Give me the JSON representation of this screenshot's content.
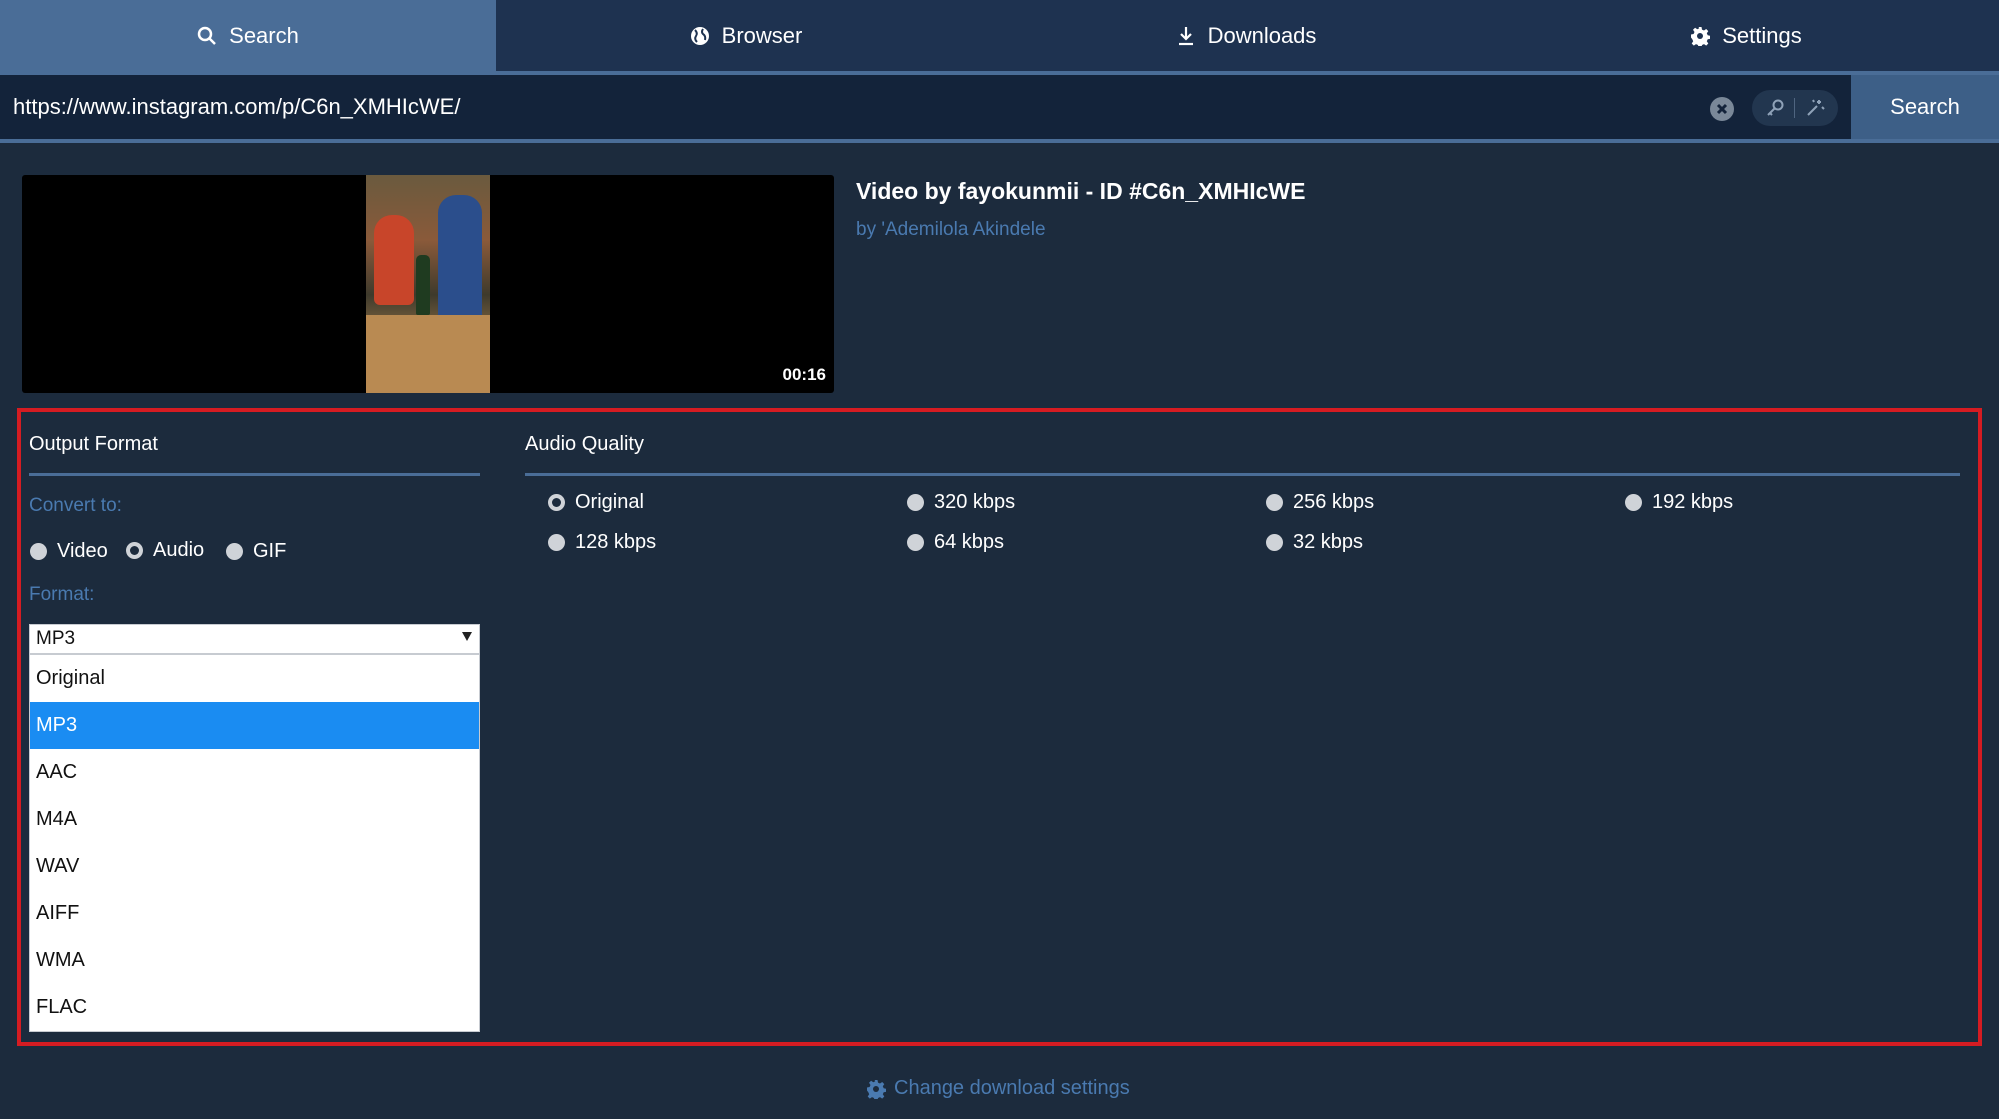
{
  "tabs": [
    {
      "label": "Search",
      "icon": "search-icon",
      "active": true
    },
    {
      "label": "Browser",
      "icon": "globe-icon",
      "active": false
    },
    {
      "label": "Downloads",
      "icon": "download-icon",
      "active": false
    },
    {
      "label": "Settings",
      "icon": "gear-icon",
      "active": false
    }
  ],
  "url_bar": {
    "value": "https://www.instagram.com/p/C6n_XMHIcWE/",
    "search_label": "Search"
  },
  "video": {
    "title": "Video by fayokunmii - ID #C6n_XMHIcWE",
    "author": "by 'Ademilola Akindele",
    "duration": "00:16"
  },
  "output_format": {
    "title": "Output Format",
    "convert_label": "Convert to:",
    "options": [
      "Video",
      "Audio",
      "GIF"
    ],
    "selected": "Audio",
    "format_label": "Format:",
    "format_value": "MP3",
    "format_options": [
      "Original",
      "MP3",
      "AAC",
      "M4A",
      "WAV",
      "AIFF",
      "WMA",
      "FLAC"
    ]
  },
  "audio_quality": {
    "title": "Audio Quality",
    "options": [
      "Original",
      "320 kbps",
      "256 kbps",
      "192 kbps",
      "128 kbps",
      "64 kbps",
      "32 kbps"
    ],
    "selected": "Original"
  },
  "footer": {
    "change_settings_label": "Change download settings"
  },
  "colors": {
    "background": "#1c2b3d",
    "tab_active": "#4a6d97",
    "accent_text": "#4a7ab0",
    "highlight_border": "#d51c22",
    "dropdown_selected": "#1a8cf2"
  }
}
